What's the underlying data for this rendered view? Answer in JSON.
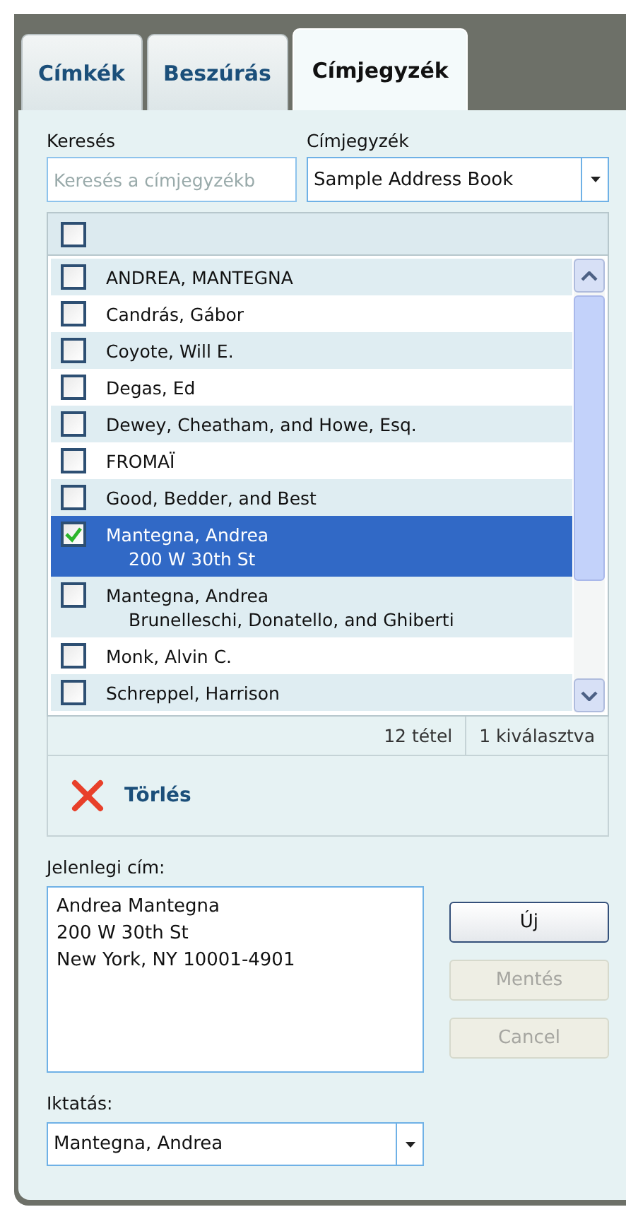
{
  "tabs": [
    {
      "label": "Címkék",
      "selected": false
    },
    {
      "label": "Beszúrás",
      "selected": false
    },
    {
      "label": "Címjegyzék",
      "selected": true
    }
  ],
  "search": {
    "label": "Keresés",
    "placeholder": "Keresés a címjegyzékb"
  },
  "address_book": {
    "label": "Címjegyzék",
    "value": "Sample Address Book"
  },
  "select_all": {
    "checked": false
  },
  "contacts": [
    {
      "name": "ANDREA, MANTEGNA",
      "checked": false,
      "selected": false
    },
    {
      "name": "Candrás, Gábor",
      "checked": false,
      "selected": false
    },
    {
      "name": "Coyote, Will E.",
      "checked": false,
      "selected": false
    },
    {
      "name": "Degas, Ed",
      "checked": false,
      "selected": false
    },
    {
      "name": "Dewey, Cheatham, and Howe, Esq.",
      "checked": false,
      "selected": false
    },
    {
      "name": "FROMAÏ",
      "checked": false,
      "selected": false
    },
    {
      "name": "Good, Bedder, and Best",
      "checked": false,
      "selected": false
    },
    {
      "name": "Mantegna, Andrea",
      "detail": "200 W 30th St",
      "checked": true,
      "selected": true
    },
    {
      "name": "Mantegna, Andrea",
      "detail": "Brunelleschi, Donatello, and Ghiberti",
      "checked": false,
      "selected": false
    },
    {
      "name": "Monk, Alvin C.",
      "checked": false,
      "selected": false
    },
    {
      "name": "Schreppel, Harrison",
      "checked": false,
      "selected": false
    }
  ],
  "status_bar": {
    "count": "12 tétel",
    "selected_count": "1 kiválasztva"
  },
  "toolbar": {
    "delete": "Törlés"
  },
  "current_address": {
    "label": "Jelenlegi cím:",
    "lines": [
      "Andrea Mantegna",
      "200 W 30th St",
      "New York, NY 10001-4901"
    ]
  },
  "buttons": [
    {
      "label": "Új",
      "disabled": false
    },
    {
      "label": "Mentés",
      "disabled": true
    },
    {
      "label": "Cancel",
      "disabled": true
    }
  ],
  "filing": {
    "label": "Iktatás:",
    "value": "Mantegna, Andrea"
  }
}
